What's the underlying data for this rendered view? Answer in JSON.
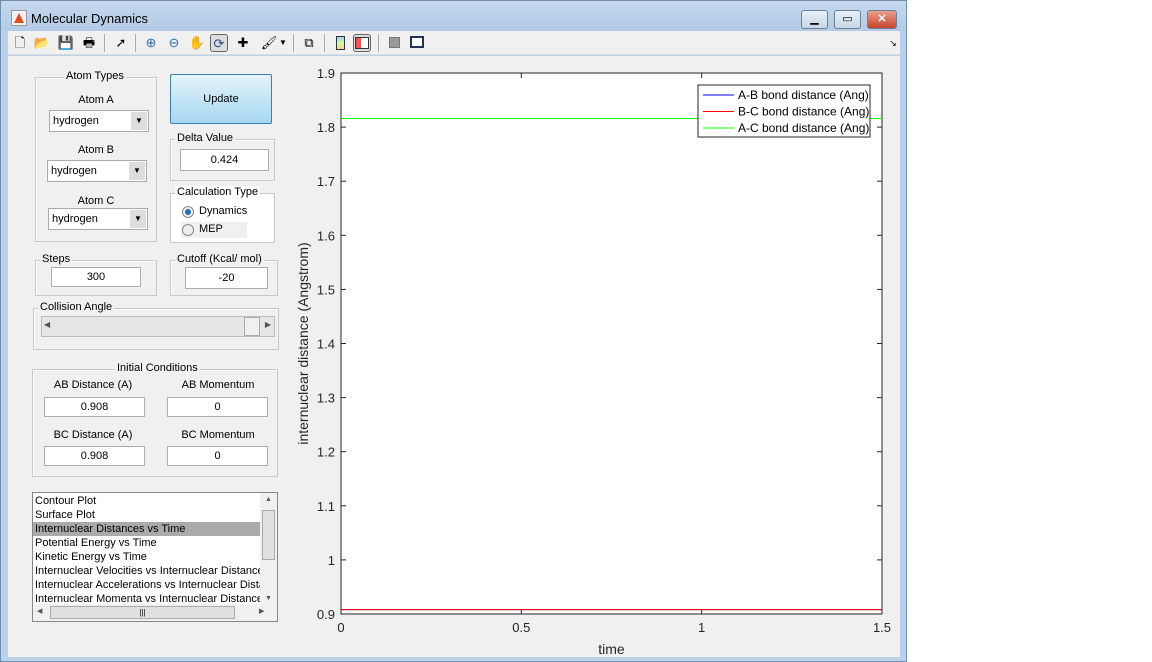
{
  "window": {
    "title": "Molecular Dynamics",
    "minimize": "▁",
    "maximize": "▭",
    "close": "✕"
  },
  "toolbar": {
    "icons": [
      "new-file-icon",
      "open-folder-icon",
      "save-icon",
      "print-icon",
      "pointer-icon",
      "zoom-in-icon",
      "zoom-out-icon",
      "pan-hand-icon",
      "rotate-3d-icon",
      "data-cursor-icon",
      "brush-icon",
      "link-plot-icon",
      "colorbar-icon",
      "legend-icon",
      "hide-plot-tools-icon",
      "show-plot-tools-icon"
    ]
  },
  "atom_types": {
    "label": "Atom Types",
    "atom_a_label": "Atom A",
    "atom_a": "hydrogen",
    "atom_b_label": "Atom B",
    "atom_b": "hydrogen",
    "atom_c_label": "Atom C",
    "atom_c": "hydrogen"
  },
  "update_label": "Update",
  "delta": {
    "label": "Delta Value",
    "value": "0.424"
  },
  "calc_type": {
    "label": "Calculation Type",
    "options": [
      "Dynamics",
      "MEP"
    ],
    "selected": "Dynamics"
  },
  "steps": {
    "label": "Steps",
    "value": "300"
  },
  "cutoff": {
    "label": "Cutoff (Kcal/ mol)",
    "value": "-20"
  },
  "collision_angle": {
    "label": "Collision Angle",
    "level_fraction": 1.0
  },
  "initial_conditions": {
    "label": "Initial Conditions",
    "ab_distance_label": "AB Distance (A)",
    "ab_distance": "0.908",
    "ab_momentum_label": "AB Momentum",
    "ab_momentum": "0",
    "bc_distance_label": "BC Distance (A)",
    "bc_distance": "0.908",
    "bc_momentum_label": "BC Momentum",
    "bc_momentum": "0"
  },
  "plot_list": {
    "items": [
      "Contour Plot",
      "Surface Plot",
      "Internuclear Distances vs Time",
      "Potential Energy vs Time",
      "Kinetic Energy vs Time",
      "Internuclear Velocities vs Internuclear Distance",
      "Internuclear Accelerations vs Internuclear Distance",
      "Internuclear Momenta vs Internuclear Distance"
    ],
    "selected": 2
  },
  "chart_data": {
    "type": "line",
    "xlabel": "time",
    "ylabel": "internuclear distance (Angstrom)",
    "xlim": [
      0,
      1.5
    ],
    "ylim": [
      0.9,
      1.9
    ],
    "xticks": [
      "0",
      "0.5",
      "1",
      "1.5"
    ],
    "yticks": [
      "0.9",
      "1",
      "1.1",
      "1.2",
      "1.3",
      "1.4",
      "1.5",
      "1.6",
      "1.7",
      "1.8",
      "1.9"
    ],
    "legend_position": "top-right",
    "grid": false,
    "series": [
      {
        "name": "A-B bond distance (Ang)",
        "color": "#0000ff",
        "x": [
          0,
          1.5
        ],
        "y": [
          0.908,
          0.908
        ]
      },
      {
        "name": "B-C bond distance (Ang)",
        "color": "#ff0000",
        "x": [
          0,
          1.5
        ],
        "y": [
          0.908,
          0.908
        ]
      },
      {
        "name": "A-C bond distance (Ang)",
        "color": "#00ff00",
        "x": [
          0,
          1.5
        ],
        "y": [
          1.816,
          1.816
        ]
      }
    ]
  }
}
